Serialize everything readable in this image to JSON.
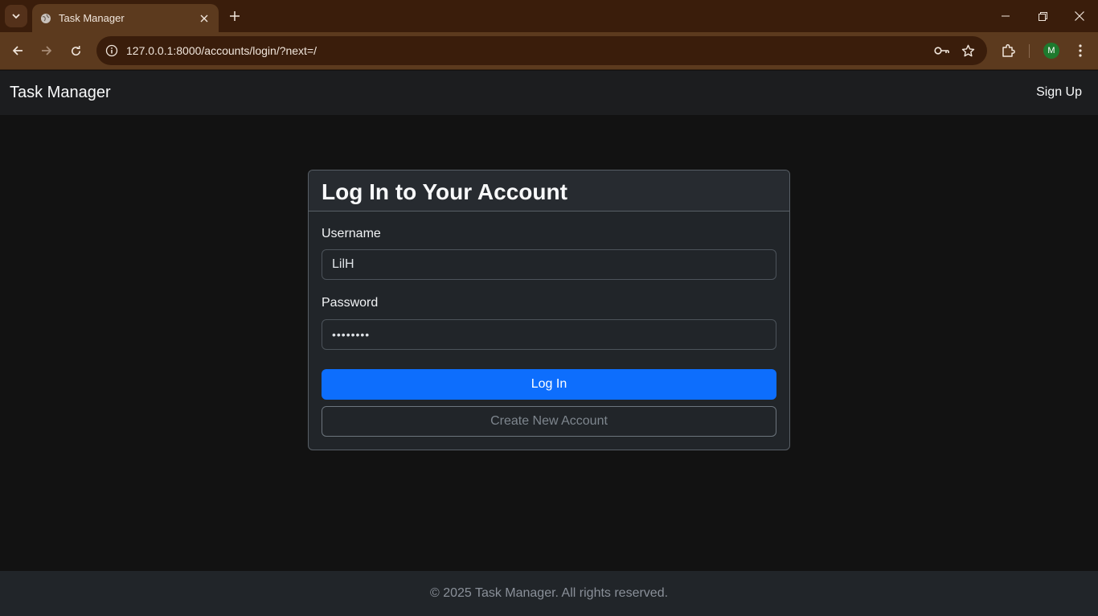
{
  "browser": {
    "tab_title": "Task Manager",
    "url": "127.0.0.1:8000/accounts/login/?next=/",
    "profile_initial": "M",
    "profile_color": "#1e7a2e",
    "chrome_color": "#5c3a1e"
  },
  "navbar": {
    "brand": "Task Manager",
    "signup_label": "Sign Up"
  },
  "login_card": {
    "title": "Log In to Your Account",
    "username_label": "Username",
    "username_value": "LilH",
    "password_label": "Password",
    "password_value": "••••••••",
    "login_button": "Log In",
    "create_account_button": "Create New Account"
  },
  "footer": {
    "text": "© 2025 Task Manager. All rights reserved."
  },
  "colors": {
    "primary": "#0d6efd",
    "page_background": "#121212",
    "card_background": "#212529"
  }
}
